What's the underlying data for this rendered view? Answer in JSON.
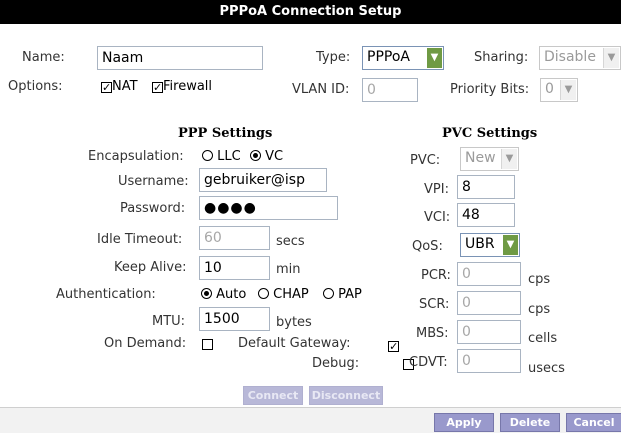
{
  "title": "PPPoA Connection Setup",
  "top": {
    "name_label": "Name:",
    "name_value": "Naam",
    "type_label": "Type:",
    "type_value": "PPPoA",
    "sharing_label": "Sharing:",
    "sharing_value": "Disable",
    "options_label": "Options:",
    "nat_label": "NAT",
    "firewall_label": "Firewall",
    "nat_checked": true,
    "firewall_checked": true,
    "vlan_label": "VLAN ID:",
    "vlan_value": "0",
    "priority_label": "Priority Bits:",
    "priority_value": "0"
  },
  "ppp": {
    "heading": "PPP Settings",
    "encapsulation_label": "Encapsulation:",
    "llc_label": "LLC",
    "vc_label": "VC",
    "encapsulation_selected": "VC",
    "username_label": "Username:",
    "username_value": "gebruiker@isp",
    "password_label": "Password:",
    "password_value": "●●●●",
    "idle_label": "Idle Timeout:",
    "idle_value": "60",
    "idle_unit": "secs",
    "keepalive_label": "Keep Alive:",
    "keepalive_value": "10",
    "keepalive_unit": "min",
    "auth_label": "Authentication:",
    "auth_auto": "Auto",
    "auth_chap": "CHAP",
    "auth_pap": "PAP",
    "auth_selected": "Auto",
    "mtu_label": "MTU:",
    "mtu_value": "1500",
    "mtu_unit": "bytes",
    "ondemand_label": "On Demand:",
    "ondemand_checked": false,
    "gateway_label": "Default Gateway:",
    "gateway_checked": true,
    "debug_label": "Debug:",
    "debug_checked": false,
    "connect_label": "Connect",
    "disconnect_label": "Disconnect"
  },
  "pvc": {
    "heading": "PVC Settings",
    "pvc_label": "PVC:",
    "pvc_value": "New",
    "vpi_label": "VPI:",
    "vpi_value": "8",
    "vci_label": "VCI:",
    "vci_value": "48",
    "qos_label": "QoS:",
    "qos_value": "UBR",
    "pcr_label": "PCR:",
    "pcr_value": "0",
    "pcr_unit": "cps",
    "scr_label": "SCR:",
    "scr_value": "0",
    "scr_unit": "cps",
    "mbs_label": "MBS:",
    "mbs_value": "0",
    "mbs_unit": "cells",
    "cdvt_label": "CDVT:",
    "cdvt_value": "0",
    "cdvt_unit": "usecs"
  },
  "footer": {
    "apply_label": "Apply",
    "delete_label": "Delete",
    "cancel_label": "Cancel"
  },
  "colors": {
    "titlebar": "#000000",
    "button": "#9999cc",
    "dropdown_arrow": "#6f9a44"
  }
}
